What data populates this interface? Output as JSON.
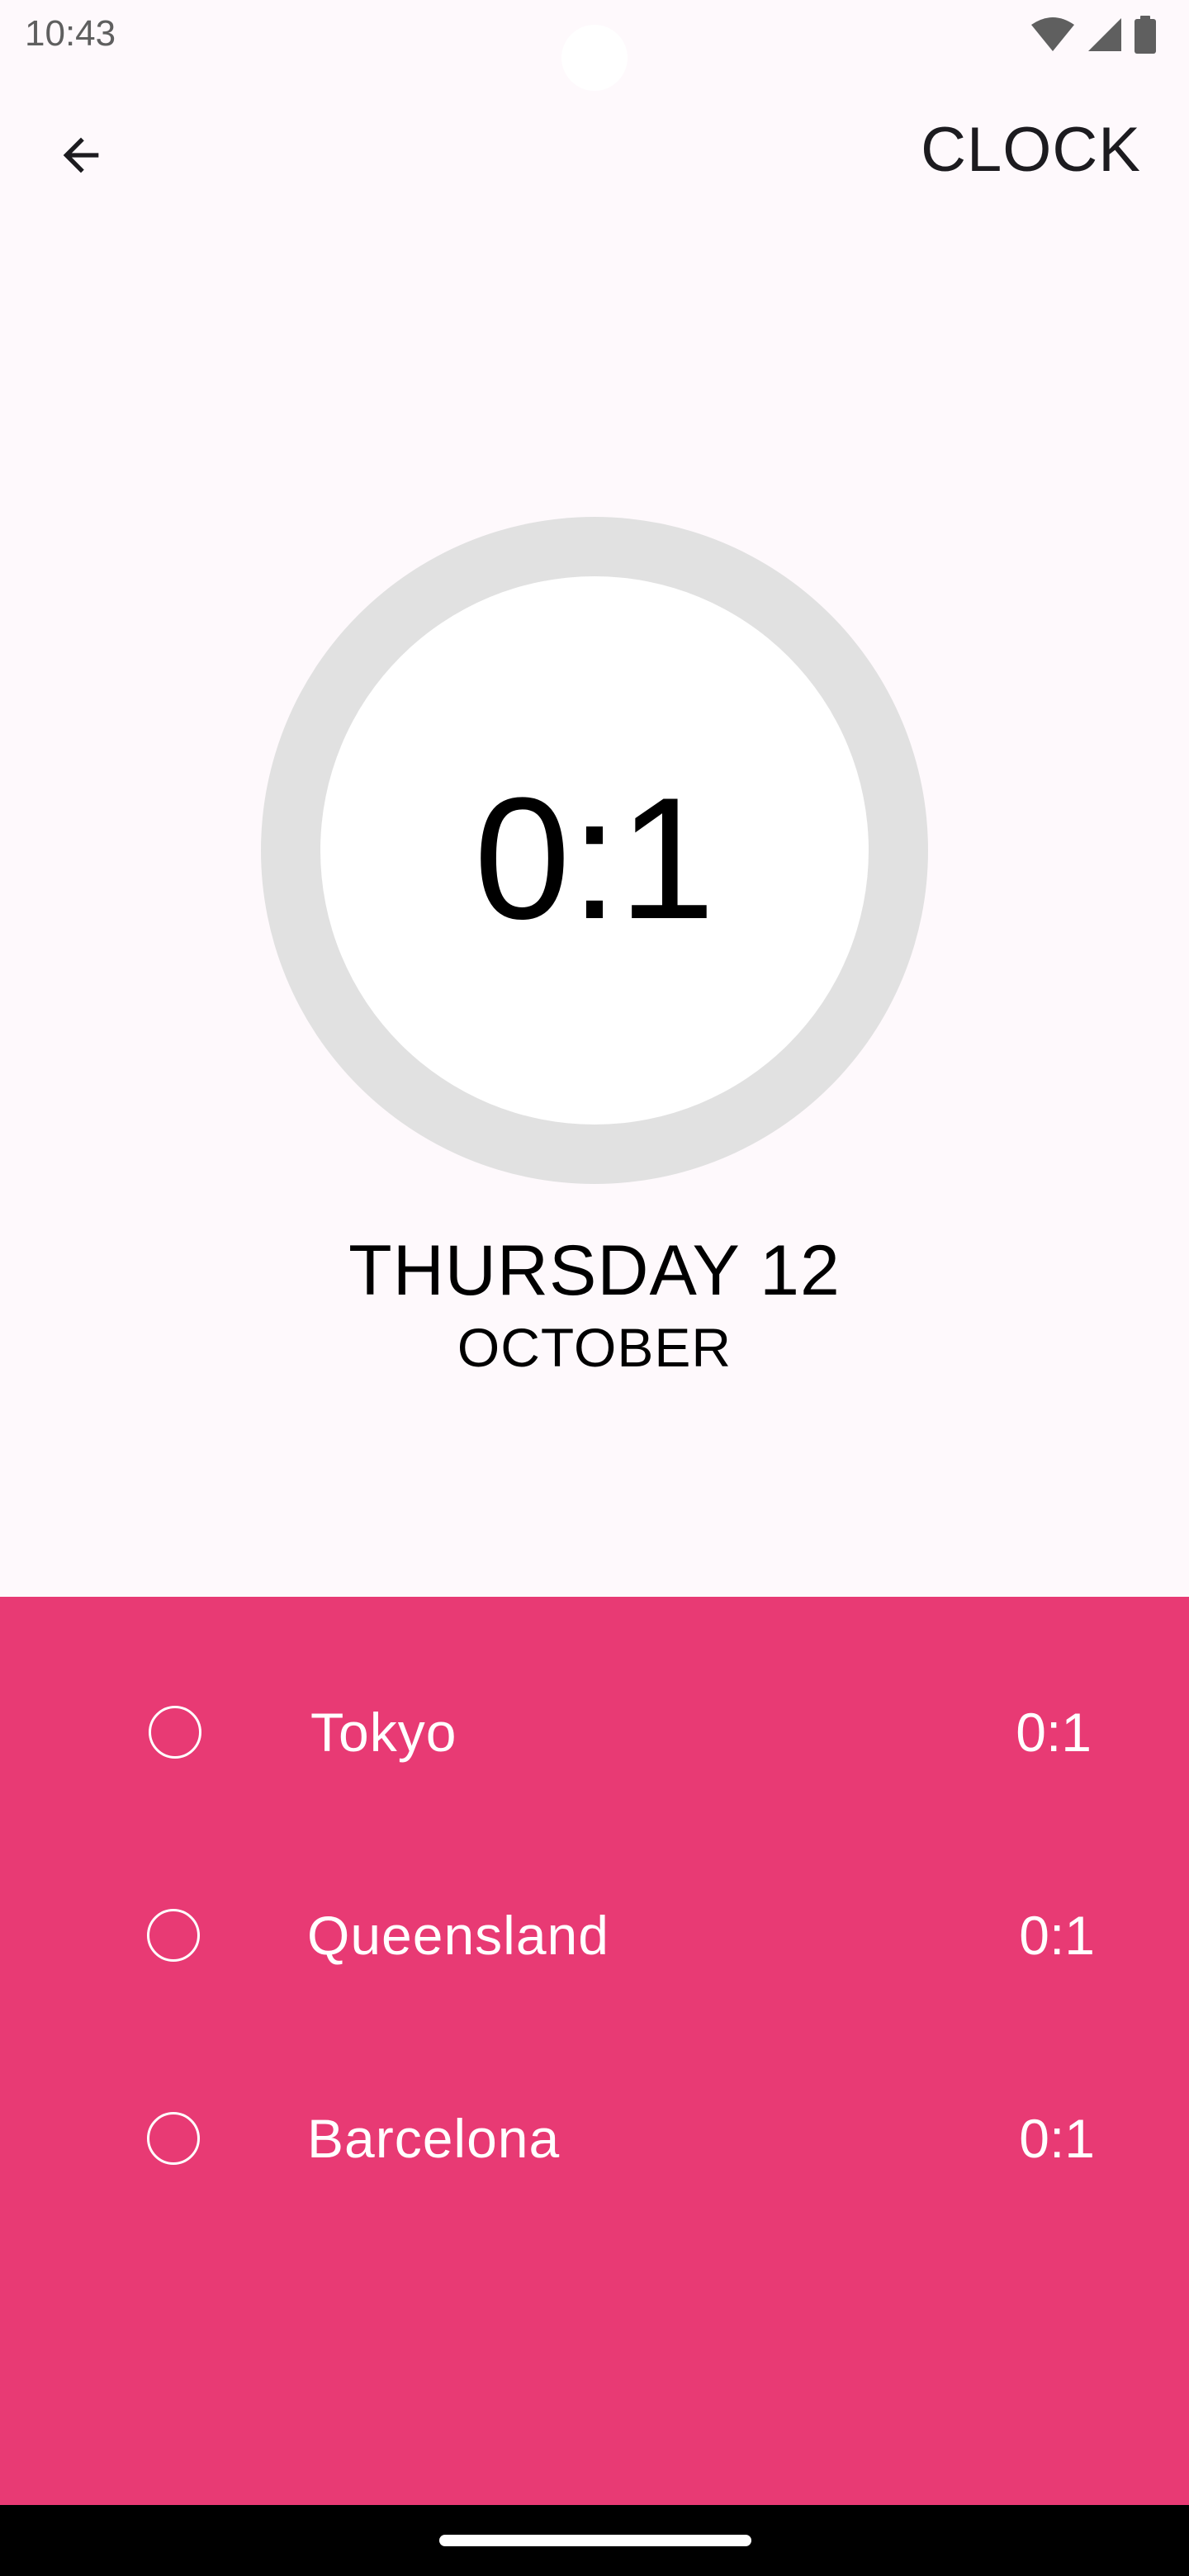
{
  "status_bar": {
    "time": "10:43",
    "icons": [
      "wifi-icon",
      "signal-icon",
      "battery-icon"
    ]
  },
  "app_bar": {
    "back_icon": "arrow-left-icon",
    "title": "CLOCK"
  },
  "dial": {
    "time": "0:1"
  },
  "date": {
    "day": "THURSDAY 12",
    "month": "OCTOBER"
  },
  "cities": [
    {
      "name": "Tokyo",
      "time": "0:1"
    },
    {
      "name": "Queensland",
      "time": "0:1"
    },
    {
      "name": "Barcelona",
      "time": "0:1"
    }
  ],
  "colors": {
    "background": "#fef9fc",
    "accent": "#e83a74",
    "dial_ring": "#e1e1e1",
    "dial_face": "#ffffff"
  }
}
